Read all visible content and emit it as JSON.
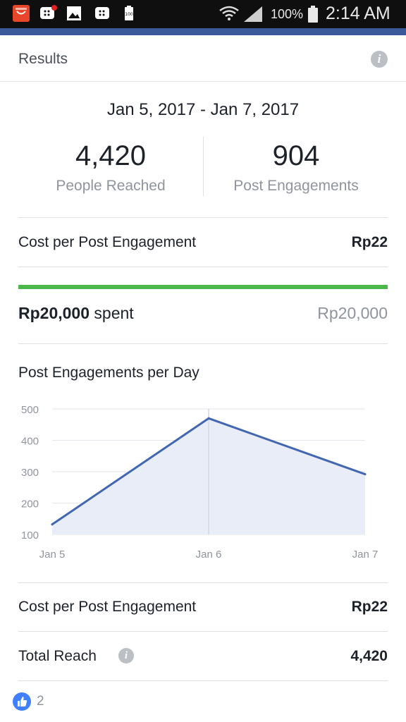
{
  "status_bar": {
    "battery_percent": "100%",
    "time": "2:14 AM",
    "app_icons": [
      "aliexpress-icon",
      "bbm-notification-icon",
      "gallery-icon",
      "bbm-icon",
      "battery-100-icon"
    ]
  },
  "header": {
    "title": "Results"
  },
  "date_range": "Jan 5, 2017 - Jan 7, 2017",
  "stats": {
    "people_reached": {
      "value": "4,420",
      "label": "People Reached"
    },
    "post_engagements": {
      "value": "904",
      "label": "Post Engagements"
    }
  },
  "cost_per_engagement_top": {
    "label": "Cost per Post Engagement",
    "value": "Rp22"
  },
  "budget": {
    "spent_amount": "Rp20,000",
    "spent_suffix": " spent",
    "total": "Rp20,000",
    "progress_fraction": 1.0
  },
  "chart_title": "Post Engagements per Day",
  "chart_data": {
    "type": "area",
    "x": [
      "Jan 5",
      "Jan 6",
      "Jan 7"
    ],
    "values": [
      132,
      470,
      292
    ],
    "ylim": [
      100,
      500
    ],
    "yticks": [
      500,
      400,
      300,
      200,
      100
    ],
    "grid": true,
    "line_color": "#4267b2",
    "fill_color": "#e9edf8"
  },
  "cost_per_engagement_bottom": {
    "label": "Cost per Post Engagement",
    "value": "Rp22"
  },
  "total_reach": {
    "label": "Total Reach",
    "value": "4,420"
  },
  "likes": {
    "count": "2"
  },
  "colors": {
    "accent": "#3b5998",
    "progress": "#4cb84c",
    "muted_text": "#90949c"
  }
}
